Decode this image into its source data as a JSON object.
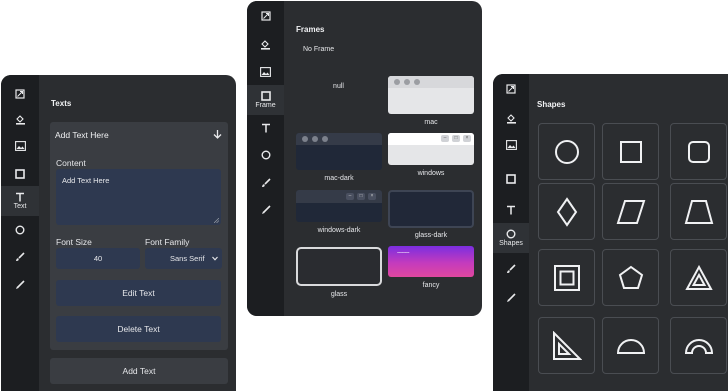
{
  "text_panel": {
    "rail": [
      {
        "icon": "frame-icon"
      },
      {
        "icon": "fill-icon"
      },
      {
        "icon": "image-icon"
      },
      {
        "icon": "square-icon"
      },
      {
        "icon": "text-icon",
        "label": "Text"
      },
      {
        "icon": "circle-icon"
      },
      {
        "icon": "brush-icon"
      },
      {
        "icon": "pen-icon"
      }
    ],
    "title": "Texts",
    "card_title": "Add Text Here",
    "content_label": "Content",
    "content_value": "Add Text Here",
    "font_size_label": "Font Size",
    "font_size_value": "40",
    "font_family_label": "Font Family",
    "font_family_value": "Sans Serif",
    "edit_label": "Edit Text",
    "delete_label": "Delete Text",
    "add_label": "Add Text"
  },
  "frames_panel": {
    "rail_active_label": "Frame",
    "title": "Frames",
    "no_frame": "No Frame",
    "frames": [
      "null",
      "mac",
      "mac-dark",
      "windows",
      "windows-dark",
      "glass-dark",
      "glass",
      "fancy"
    ],
    "fancy_header": "--------"
  },
  "shapes_panel": {
    "rail_active_label": "Shapes",
    "title": "Shapes",
    "shapes": [
      "circle",
      "square",
      "rounded-square",
      "diamond",
      "parallelogram",
      "trapezoid",
      "double-square",
      "pentagon",
      "double-triangle",
      "right-triangle",
      "semicircle",
      "arch"
    ]
  },
  "colors": {
    "panel": "#2b2d30",
    "rail": "#1c1e21",
    "card": "#3a3d42",
    "field": "#2e3950",
    "fancy_top": "#7b2ee0",
    "fancy_bottom": "#e0479e"
  }
}
